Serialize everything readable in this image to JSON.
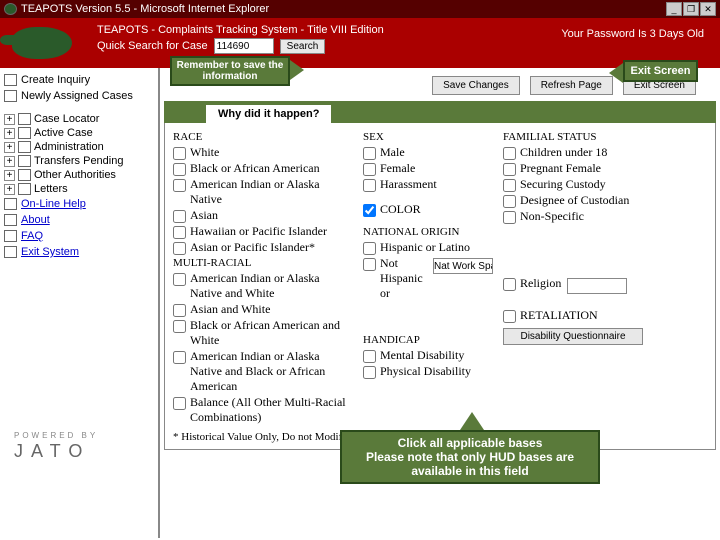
{
  "titlebar": "TEAPOTS Version 5.5 - Microsoft Internet Explorer",
  "header": {
    "title": "TEAPOTS - Complaints Tracking System - Title VIII Edition",
    "quicksearch_label": "Quick Search for Case",
    "quicksearch_value": "114690",
    "search_btn": "Search",
    "password_msg": "Your Password Is 3 Days Old"
  },
  "sidebar": {
    "top": [
      "Create Inquiry",
      "Newly Assigned Cases"
    ],
    "tree": [
      "Case Locator",
      "Active Case",
      "Administration",
      "Transfers Pending",
      "Other Authorities",
      "Letters"
    ],
    "links": [
      "On-Line Help",
      "About",
      "FAQ",
      "Exit System"
    ]
  },
  "toolbar": {
    "save": "Save Changes",
    "refresh": "Refresh Page",
    "exit": "Exit Screen"
  },
  "tab": "Why did it happen?",
  "form": {
    "race_hdr": "RACE",
    "race": [
      "White",
      "Black or African American",
      "American Indian or Alaska Native",
      "Asian",
      "Hawaiian or Pacific Islander",
      "Asian or Pacific Islander*"
    ],
    "multi_hdr": "MULTI-RACIAL",
    "multi": [
      "American Indian or Alaska Native and White",
      "Asian and White",
      "Black or African American and White",
      "American Indian or Alaska Native and Black or African American",
      "Balance (All Other Multi-Racial Combinations)"
    ],
    "sex_hdr": "SEX",
    "sex": [
      "Male",
      "Female",
      "Harassment"
    ],
    "color": "COLOR",
    "nat_hdr": "NATIONAL ORIGIN",
    "nat": [
      "Hispanic or Latino",
      "Not Hispanic or"
    ],
    "nat_placeholder": "Nat Work Space",
    "religion": "Religion",
    "hand_hdr": "HANDICAP",
    "hand": [
      "Mental Disability",
      "Physical Disability"
    ],
    "fam_hdr": "FAMILIAL STATUS",
    "fam": [
      "Children under 18",
      "Pregnant Female",
      "Securing Custody",
      "Designee of Custodian",
      "Non-Specific"
    ],
    "retaliation": "RETALIATION",
    "qbtn": "Disability Questionnaire",
    "note": "* Historical Value Only, Do not Modify"
  },
  "callouts": {
    "save": "Remember to save the information",
    "exit": "Exit Screen",
    "bottom": "Click all applicable bases\nPlease note that only HUD bases are available in this field"
  },
  "powered": "POWERED BY",
  "jato": "JATO"
}
